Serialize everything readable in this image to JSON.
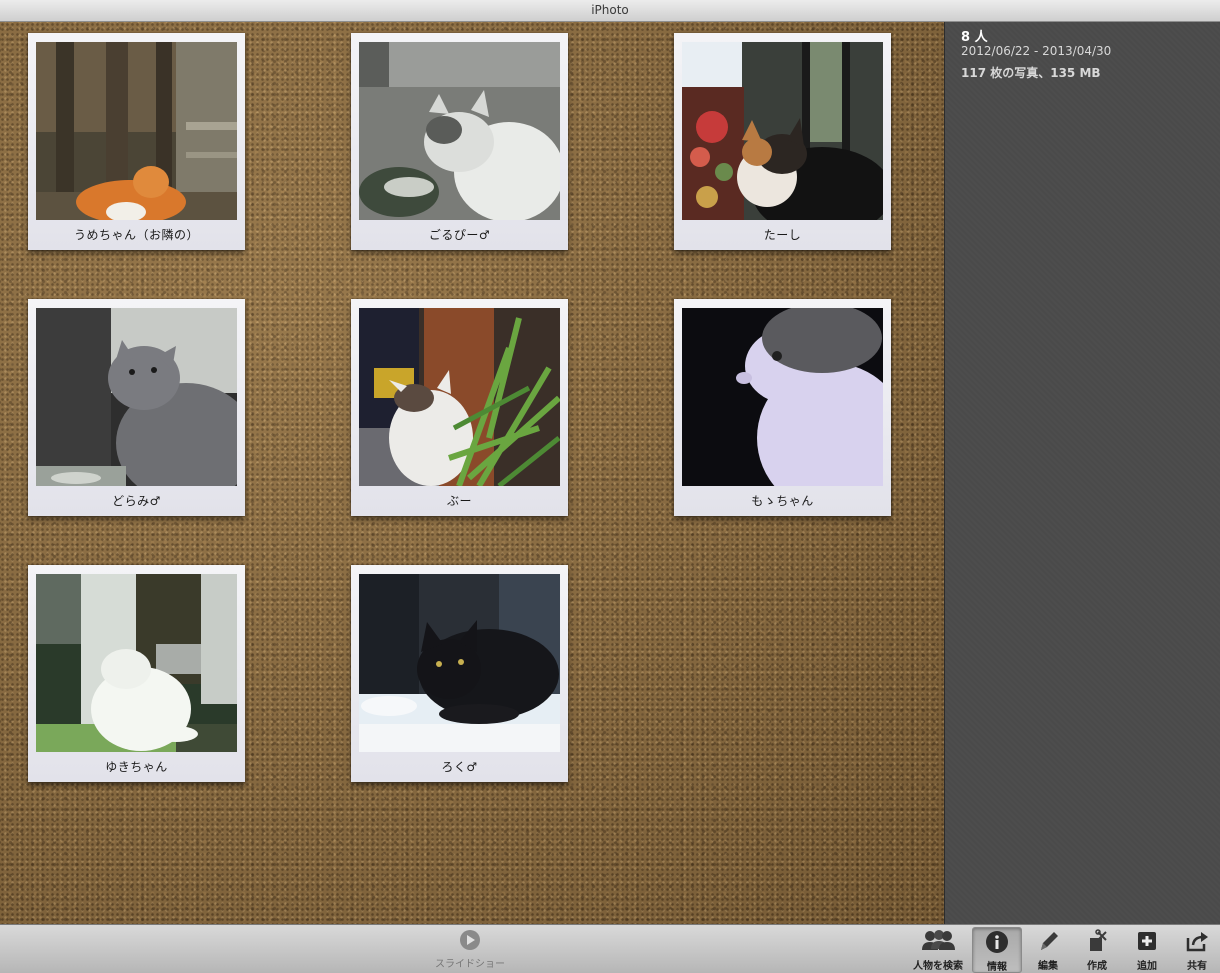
{
  "window": {
    "title": "iPhoto"
  },
  "faces": [
    {
      "name": "うめちゃん（お隣の）"
    },
    {
      "name": "ごるぴー♂"
    },
    {
      "name": "たーし"
    },
    {
      "name": "どらみ♂"
    },
    {
      "name": "ぶー"
    },
    {
      "name": "もゝちゃん"
    },
    {
      "name": "ゆきちゃん"
    },
    {
      "name": "ろく♂"
    }
  ],
  "info": {
    "count": "8 人",
    "date_range": "2012/06/22 - 2013/04/30",
    "stats": "117 枚の写真、135 MB"
  },
  "toolbar": {
    "slideshow_label": "スライドショー",
    "find_people_label": "人物を検索",
    "info_label": "情報",
    "edit_label": "編集",
    "create_label": "作成",
    "add_label": "追加",
    "share_label": "共有"
  }
}
